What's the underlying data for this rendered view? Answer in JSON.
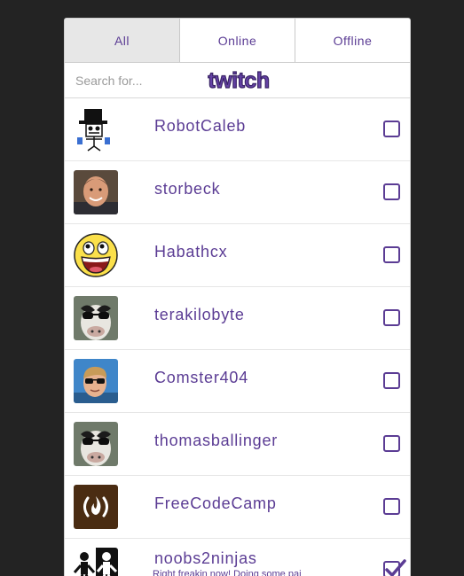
{
  "tabs": [
    {
      "label": "All",
      "active": true
    },
    {
      "label": "Online",
      "active": false
    },
    {
      "label": "Offline",
      "active": false
    }
  ],
  "search": {
    "placeholder": "Search for...",
    "value": ""
  },
  "logo": {
    "text": "twitch",
    "color": "#6441a5"
  },
  "accent_color": "#5b3c94",
  "channels": [
    {
      "name": "RobotCaleb",
      "avatar": "top-hat-stickman-avatar",
      "checked": false,
      "status": ""
    },
    {
      "name": "storbeck",
      "avatar": "man-portrait-avatar",
      "checked": false,
      "status": ""
    },
    {
      "name": "Habathcx",
      "avatar": "awesome-smiley-avatar",
      "checked": false,
      "status": ""
    },
    {
      "name": "terakilobyte",
      "avatar": "cow-sunglasses-avatar",
      "checked": false,
      "status": ""
    },
    {
      "name": "Comster404",
      "avatar": "man-sunglasses-avatar",
      "checked": false,
      "status": ""
    },
    {
      "name": "thomasballinger",
      "avatar": "cow-sunglasses-avatar",
      "checked": false,
      "status": ""
    },
    {
      "name": "FreeCodeCamp",
      "avatar": "freecodecamp-logo-avatar",
      "checked": false,
      "status": ""
    },
    {
      "name": "noobs2ninjas",
      "avatar": "ninja-figures-avatar",
      "checked": true,
      "status": "Right freakin now! Doing some pai"
    }
  ]
}
